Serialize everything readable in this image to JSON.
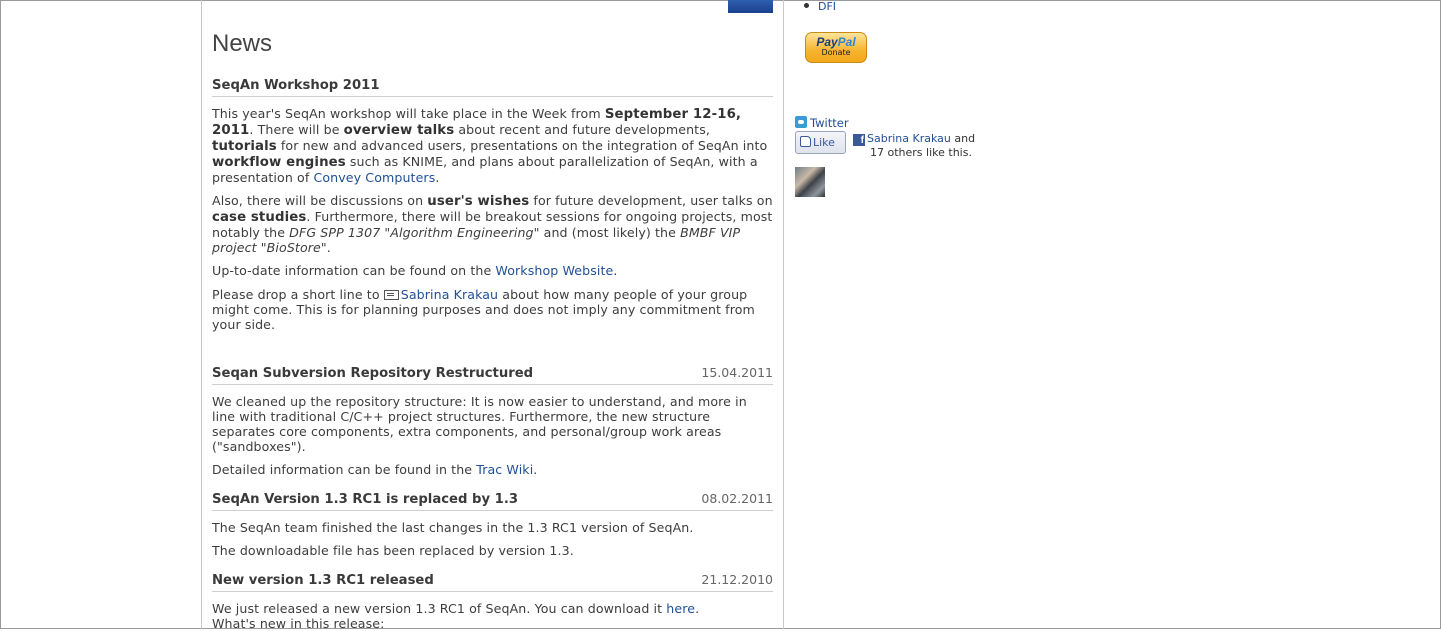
{
  "page": {
    "title": "News"
  },
  "articles": [
    {
      "title": "SeqAn Workshop 2011",
      "date": "",
      "p1": {
        "t1": "This year's SeqAn workshop will take place in the Week from ",
        "b1": "September 12-16, 2011",
        "t2": ". There will be ",
        "b2": "overview talks",
        "t3": " about recent and future developments, ",
        "b3": "tutorials",
        "t4": " for new and advanced users, presentations on the integration of SeqAn into ",
        "b4": "workflow engines",
        "t5": " such as KNIME, and plans about parallelization of SeqAn, with a presentation of ",
        "link": "Convey Computers",
        "t6": "."
      },
      "p2": {
        "t1": "Also, there will be discussions on ",
        "b1": "user's wishes",
        "t2": " for future development, user talks on ",
        "b2": "case studies",
        "t3": ". Furthermore, there will be breakout sessions for ongoing projects, most notably the ",
        "i1": "DFG SPP 1307 \"Algorithm Engineering\"",
        "t4": " and (most likely) the ",
        "i2": "BMBF VIP project \"BioStore\"",
        "t5": "."
      },
      "p3": {
        "t1": "Up-to-date information can be found on the ",
        "link": "Workshop Website",
        "t2": "."
      },
      "p4": {
        "t1": "Please drop a short line to ",
        "link": "Sabrina Krakau",
        "t2": " about how many people of your group might come. This is for planning purposes and does not imply any commitment from your side."
      }
    },
    {
      "title": "Seqan Subversion Repository Restructured",
      "date": "15.04.2011",
      "p1": "We cleaned up the repository structure: It is now easier to understand, and more in line with traditional C/C++ project structures. Furthermore, the new structure separates core components, extra components, and personal/group work areas (\"sandboxes\").",
      "p2": {
        "t1": "Detailed information can be found in the ",
        "link": "Trac Wiki",
        "t2": "."
      }
    },
    {
      "title": "SeqAn Version 1.3 RC1 is replaced by 1.3",
      "date": "08.02.2011",
      "p1": "The SeqAn team finished the last changes in the 1.3 RC1 version of SeqAn.",
      "p2": "The downloadable file has been replaced by version 1.3."
    },
    {
      "title": "New version 1.3 RC1 released",
      "date": "21.12.2010",
      "p1": {
        "t1": "We just released a new version 1.3 RC1 of SeqAn. You can download it ",
        "link": "here",
        "t2": "."
      },
      "p2": "What's new in this release:"
    }
  ],
  "sidebar": {
    "bullet_link": "DFI",
    "paypal": {
      "logo_a": "Pay",
      "logo_b": "Pal",
      "label": "Donate"
    },
    "twitter_label": "Twitter",
    "like_label": "Like",
    "fb": {
      "name": "Sabrina Krakau",
      "t1": " and",
      "t2": "17 others like this."
    }
  }
}
